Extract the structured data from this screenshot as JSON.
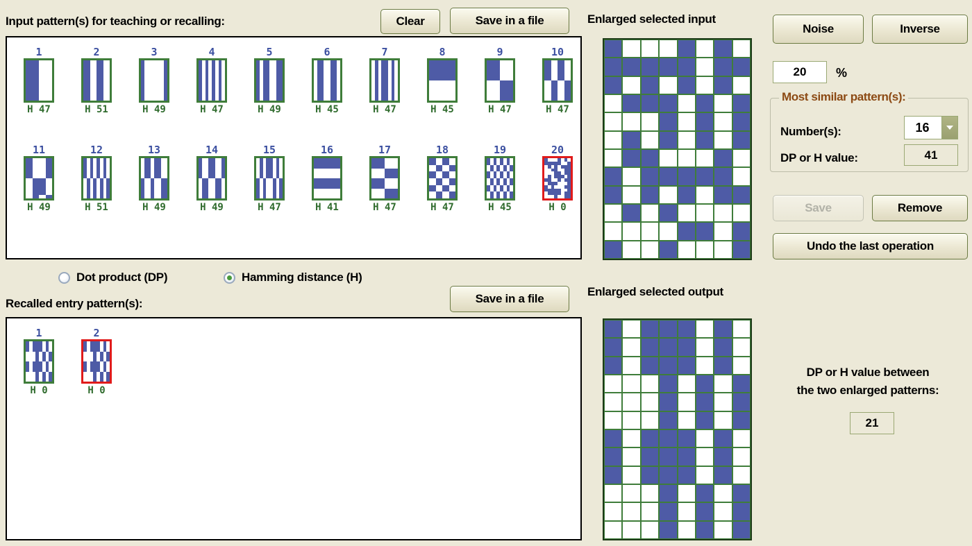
{
  "window": {
    "background": "#ece9d8",
    "accent_blue": "#4e5ba6",
    "accent_green": "#3f7d3a",
    "accent_red": "#e01b1b"
  },
  "input_section": {
    "title": "Input pattern(s) for teaching or recalling:",
    "clear_label": "Clear",
    "save_file_label": "Save in a file",
    "patterns": [
      {
        "number": "1",
        "h_label": "H  47",
        "selected": false,
        "cells": "1111000011110000111100001111000011110000111100001111000011110000111100001111000011110000111100001111000011110000"
      },
      {
        "number": "2",
        "h_label": "H  51",
        "selected": false,
        "cells": "110011001100110011001100110011001100110011001100110011001100110011001100110011001100110011001100110011001100"
      },
      {
        "number": "3",
        "h_label": "H  49",
        "selected": false,
        "cells": "100000011000000110000001100000011000000110000001100000011000000110000001100000011000000110000001100000011000000"
      },
      {
        "number": "4",
        "h_label": "H  47",
        "selected": false,
        "cells": "101010101010101010101010101010101010101010101010101010101010101010101010101010101010101010101010101010101010"
      },
      {
        "number": "5",
        "h_label": "H  49",
        "selected": false,
        "cells": "101100111011001110110011101100111011001110110011101100111011001110110011101100111011001110110011101100111011"
      },
      {
        "number": "6",
        "h_label": "H  45",
        "selected": false,
        "cells": "011001100110011001100110011001100110011001100110011001100110011001100110011001100110011001100110011001100110"
      },
      {
        "number": "7",
        "h_label": "H  47",
        "selected": false,
        "cells": "010110100101101001011010010110100101101001011010010110100101101001011010010110100101101001011010010110100101"
      },
      {
        "number": "8",
        "h_label": "H  45",
        "selected": false,
        "cells": "111111111111111111111111111111111111111111111111000000000000000000000000000000000000000000000000000000000000"
      },
      {
        "number": "9",
        "h_label": "H  47",
        "selected": false,
        "cells": "111100001111000011110000111100001111000011110000000011110000111100001111000011110000111100001111000011110000"
      },
      {
        "number": "10",
        "h_label": "H  47",
        "selected": false,
        "cells": "110011001100110011001100110011001100110011001100001100110011001100110011001100110011001100110011001100110011"
      },
      {
        "number": "11",
        "h_label": "H  49",
        "selected": false,
        "cells": "110000111100001111000011110000111100001111000011001111000011110000111100001111000011110000110011110000110011"
      },
      {
        "number": "12",
        "h_label": "H  51",
        "selected": false,
        "cells": "101010101010101010101010101010101010101010101010010101010101010101010101010101010101010101010101010101010101"
      },
      {
        "number": "13",
        "h_label": "H  49",
        "selected": false,
        "cells": "011011000110110001101100011011000110110001101100100100111001001110010011100100111001001110010011100100111001"
      },
      {
        "number": "14",
        "h_label": "H  49",
        "selected": false,
        "cells": "100110011001100110011001100110011001100110011001011001100110011001100110011001100110011001100110010110011001"
      },
      {
        "number": "15",
        "h_label": "H  47",
        "selected": false,
        "cells": "010110100101101001011010010110100101101001011010101001011010010110100101101001011010010110100101101001011010"
      },
      {
        "number": "16",
        "h_label": "H  41",
        "selected": false,
        "cells": "111111111111111111111111000000000000000000000000111111111111111111111111000000000000000000000000000000000000"
      },
      {
        "number": "17",
        "h_label": "H  47",
        "selected": false,
        "cells": "111100001111000011110000000011110000111100001111111100001111000011110000000011110000111100001111000011111111"
      },
      {
        "number": "18",
        "h_label": "H  47",
        "selected": false,
        "cells": "110011001100110000110011001100111100110011001100001100110011001111001100110011000011001100110011110011001100"
      },
      {
        "number": "19",
        "h_label": "H  45",
        "selected": false,
        "cells": "101010101010101001010101010101011010101010101010010101010101010110101010101010100101010101010101101010101010"
      },
      {
        "number": "20",
        "h_label": "H  0",
        "selected": true,
        "cells": "100010101111100101010111001100110001101101011101110010110111000110100011111110010111101100010011001010000010"
      }
    ]
  },
  "metric_options": {
    "dot_product": {
      "label": "Dot product (DP)",
      "selected": false
    },
    "hamming": {
      "label": "Hamming distance (H)",
      "selected": true
    }
  },
  "output_section": {
    "title": "Recalled entry pattern(s):",
    "save_file_label": "Save in a file",
    "patterns": [
      {
        "number": "1",
        "h_label": "H  0",
        "selected": false,
        "cells": "101110101011101010111010000101010001010100010101101110101011101010111010000101010001010100010101000101010001"
      },
      {
        "number": "2",
        "h_label": "H  0",
        "selected": true,
        "cells": "101110101011101010111010000101010001010100010101101110101011101010111010000101010001010100010101000101010001"
      }
    ]
  },
  "enlarged_input": {
    "title": "Enlarged selected input",
    "rows": 12,
    "cols": 8,
    "cells": [
      "10001010",
      "11111011",
      "10101010",
      "01110101",
      "00010101",
      "01010101",
      "01100010",
      "10111110",
      "10101011",
      "01010000",
      "00001101",
      "10010001"
    ]
  },
  "enlarged_output": {
    "title": "Enlarged selected output",
    "rows": 12,
    "cols": 8,
    "cells": [
      "10111010",
      "10111010",
      "10111010",
      "00010101",
      "00010101",
      "00010101",
      "10111010",
      "10111010",
      "10111010",
      "00010101",
      "00010101",
      "00010101"
    ]
  },
  "tools": {
    "noise_label": "Noise",
    "inverse_label": "Inverse",
    "noise_value": "20",
    "percent_symbol": "%",
    "group_title": "Most similar pattern(s):",
    "numbers_label": "Number(s):",
    "numbers_value": "16",
    "dp_h_label": "DP or H value:",
    "dp_h_value": "41",
    "save_label": "Save",
    "save_disabled": true,
    "remove_label": "Remove",
    "undo_label": "Undo the last operation"
  },
  "comparison": {
    "line1": "DP or H value between",
    "line2": "the two enlarged patterns:",
    "value": "21"
  }
}
